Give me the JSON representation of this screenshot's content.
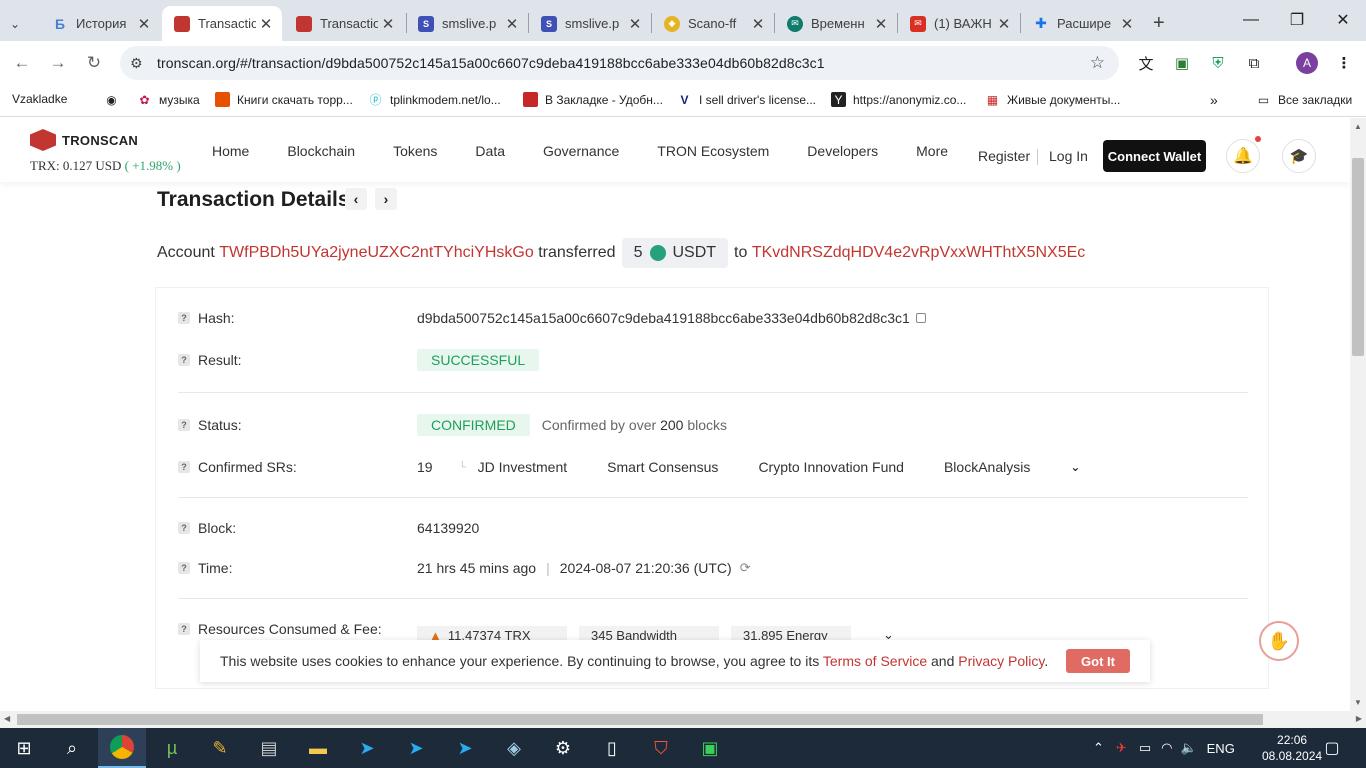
{
  "browser": {
    "tabs": [
      {
        "title": "История",
        "icon": "history-icon"
      },
      {
        "title": "Transactio",
        "icon": "tronscan-icon"
      },
      {
        "title": "Transactio",
        "icon": "tronscan-icon"
      },
      {
        "title": "smslive.p",
        "icon": "sms-icon"
      },
      {
        "title": "smslive.p",
        "icon": "sms-icon"
      },
      {
        "title": "Scano-ff",
        "icon": "scano-icon"
      },
      {
        "title": "Временн",
        "icon": "temp-icon"
      },
      {
        "title": "(1) ВАЖН",
        "icon": "mail-icon"
      },
      {
        "title": "Расшире",
        "icon": "puzzle-icon"
      }
    ],
    "url": "tronscan.org/#/transaction/d9bda500752c145a15a00c6607c9deba419188bcc6abe333e04db60b82d8c3c1",
    "profile_initial": "A",
    "bookmarks": [
      {
        "label": "Vzakladke",
        "icon": "globe-icon"
      },
      {
        "label": "музыка",
        "icon": "music-icon"
      },
      {
        "label": "Книги скачать торр...",
        "icon": "books-icon"
      },
      {
        "label": "tplinkmodem.net/lo...",
        "icon": "tplink-icon"
      },
      {
        "label": "В Закладке - Удобн...",
        "icon": "bookmark-icon"
      },
      {
        "label": "I sell driver's license...",
        "icon": "v-icon"
      },
      {
        "label": "https://anonymiz.co...",
        "icon": "y-icon"
      },
      {
        "label": "Живые документы...",
        "icon": "docs-icon"
      }
    ],
    "all_bookmarks": "Все закладки"
  },
  "site": {
    "brand": "TRONSCAN",
    "price_prefix": "TRX: 0.127 USD",
    "price_change": "( +1.98% )",
    "nav": [
      "Home",
      "Blockchain",
      "Tokens",
      "Data",
      "Governance",
      "TRON Ecosystem",
      "Developers",
      "More"
    ],
    "register": "Register",
    "login": "Log In",
    "connect_wallet": "Connect Wallet"
  },
  "tx": {
    "title": "Transaction Details",
    "summary": {
      "account_label": "Account",
      "from": "TWfPBDh5UYa2jyneUZXC2ntTYhciYHskGo",
      "transferred": "transferred",
      "amount": "5",
      "token": "USDT",
      "to_label": "to",
      "to": "TKvdNRSZdqHDV4e2vRpVxxWHThtX5NX5Ec"
    },
    "hash_label": "Hash:",
    "hash": "d9bda500752c145a15a00c6607c9deba419188bcc6abe333e04db60b82d8c3c1",
    "result_label": "Result:",
    "result": "SUCCESSFUL",
    "status_label": "Status:",
    "status": "CONFIRMED",
    "confirmed_prefix": "Confirmed by over",
    "confirmed_count": "200",
    "confirmed_suffix": "blocks",
    "srs_label": "Confirmed SRs:",
    "srs_count": "19",
    "srs": [
      "JD Investment",
      "Smart Consensus",
      "Crypto Innovation Fund",
      "BlockAnalysis"
    ],
    "block_label": "Block:",
    "block": "64139920",
    "time_label": "Time:",
    "time_ago": "21 hrs 45 mins ago",
    "time_utc": "2024-08-07 21:20:36 (UTC)",
    "resources_label": "Resources Consumed & Fee:",
    "fee": "11.47374  TRX",
    "bandwidth": "345  Bandwidth",
    "energy": "31,895  Energy"
  },
  "cookie": {
    "text": "This website uses cookies to enhance your experience. By continuing to browse, you agree to its",
    "terms": "Terms of Service",
    "and": "and",
    "privacy": "Privacy Policy",
    "period": ".",
    "button": "Got It"
  },
  "taskbar": {
    "lang": "ENG",
    "time": "22:06",
    "date": "08.08.2024"
  },
  "colors": {
    "tron_red": "#c23631",
    "success_green": "#1f9e5c",
    "taskbar": "#1c2a3a"
  }
}
